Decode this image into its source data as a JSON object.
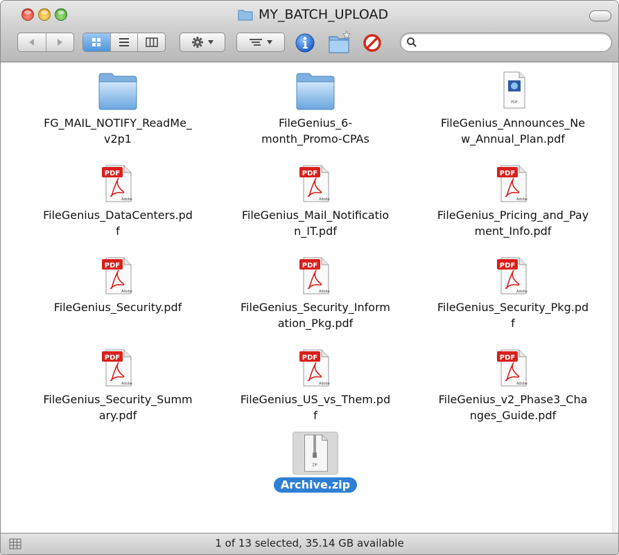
{
  "window": {
    "title": "MY_BATCH_UPLOAD"
  },
  "toolbar": {
    "back_icon": "back-arrow-icon",
    "forward_icon": "forward-arrow-icon",
    "view_modes": [
      "icon-view",
      "list-view",
      "column-view"
    ],
    "active_view": "icon-view",
    "action_icon": "gear-icon",
    "arrange_icon": "arrange-icon",
    "info_icon": "info-icon",
    "new_folder_icon": "new-folder-icon",
    "delete_icon": "no-entry-icon",
    "search": {
      "value": "",
      "placeholder": ""
    }
  },
  "files": [
    {
      "name": "FG_MAIL_NOTIFY_ReadMe_\nv2p1",
      "kind": "folder"
    },
    {
      "name": "FileGenius_6-\nmonth_Promo-CPAs",
      "kind": "folder"
    },
    {
      "name": "FileGenius_Announces_Ne\nw_Annual_Plan.pdf",
      "kind": "pdf-preview",
      "badge": "PDF"
    },
    {
      "name": "FileGenius_DataCenters.pd\nf",
      "kind": "pdf",
      "badge": "PDF"
    },
    {
      "name": "FileGenius_Mail_Notificatio\nn_IT.pdf",
      "kind": "pdf",
      "badge": "PDF"
    },
    {
      "name": "FileGenius_Pricing_and_Pay\nment_Info.pdf",
      "kind": "pdf",
      "badge": "PDF"
    },
    {
      "name": "FileGenius_Security.pdf",
      "kind": "pdf",
      "badge": "PDF"
    },
    {
      "name": "FileGenius_Security_Inform\nation_Pkg.pdf",
      "kind": "pdf",
      "badge": "PDF"
    },
    {
      "name": "FileGenius_Security_Pkg.pd\nf",
      "kind": "pdf",
      "badge": "PDF"
    },
    {
      "name": "FileGenius_Security_Summ\nary.pdf",
      "kind": "pdf",
      "badge": "PDF"
    },
    {
      "name": "FileGenius_US_vs_Them.pd\nf",
      "kind": "pdf",
      "badge": "PDF"
    },
    {
      "name": "FileGenius_v2_Phase3_Cha\nnges_Guide.pdf",
      "kind": "pdf",
      "badge": "PDF"
    },
    {
      "name": "Archive.zip",
      "kind": "zip",
      "badge": "ZIP",
      "selected": true
    }
  ],
  "status": {
    "text": "1 of 13 selected, 35.14 GB available"
  },
  "colors": {
    "selection": "#2f7fd5",
    "pdf_red": "#d8201c",
    "folder_blue": "#7fb6e8"
  }
}
